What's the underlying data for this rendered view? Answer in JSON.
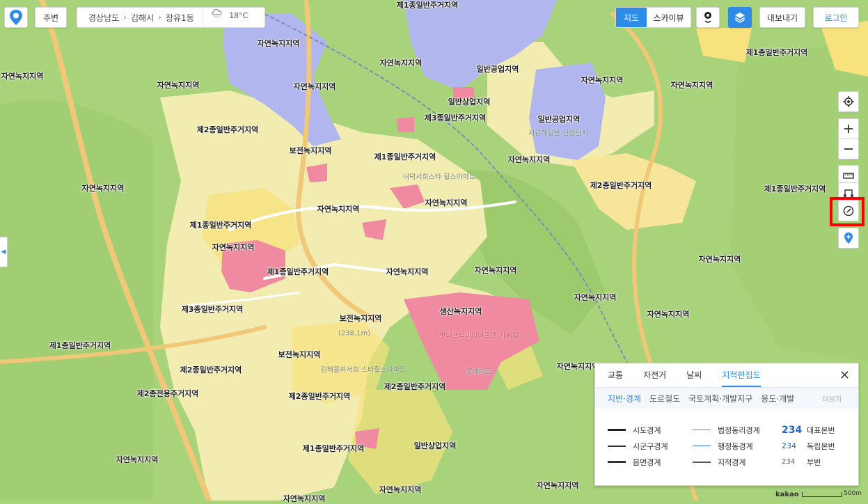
{
  "topbar": {
    "nearby_label": "주변",
    "breadcrumb": [
      "경상남도",
      "김해시",
      "장유1동"
    ],
    "weather_temp": "18°C",
    "map_type_map": "지도",
    "map_type_sky": "스카이뷰",
    "export_label": "내보내기",
    "login_label": "로그인"
  },
  "map_labels": [
    "제1종일반주거지역",
    "제1종일반주거지역",
    "자연녹지지역",
    "자연녹지지역",
    "일반공업지역",
    "자연녹지지역",
    "자연녹지지역",
    "자연녹지지역",
    "자연녹지지역",
    "자연녹지지역",
    "일반상업지역",
    "제3종일반주거지역",
    "일반공업지역",
    "제2종일반주거지역",
    "보전녹지지역",
    "제1종일반주거지역",
    "자연녹지지역",
    "자연녹지지역",
    "제2종일반주거지역",
    "제1종일반주거지역",
    "자연녹지지역",
    "자연녹지지역",
    "제1종일반주거지역",
    "자연녹지지역",
    "자연녹지지역",
    "제1종일반주거지역",
    "자연녹지지역",
    "자연녹지지역",
    "자연녹지지역",
    "자연녹지지역",
    "제3종일반주거지역",
    "생산녹지지역",
    "보전녹지지역",
    "자연녹지지역",
    "제1종일반주거지역",
    "보전녹지지역",
    "제2종일반주거지역",
    "제2종일반주거지역",
    "제2종전용주거지역",
    "제2종일반주거지역",
    "일반상업지역",
    "제1종일반주거지역",
    "자연녹지지역",
    "자연녹지지역",
    "자연녹지지역",
    "자연녹지지역"
  ],
  "poi_labels": [
    "서김해일반 산업단지",
    "롯데프리미엄아울렛 김해점",
    "(238.1m)",
    "롯데마트",
    "내덕서희스타 힐스아파트",
    "김해율하서희 스타힐스아파트"
  ],
  "panel": {
    "tabs": [
      "교통",
      "자전거",
      "날씨",
      "지적편집도"
    ],
    "active_tab": "지적편집도",
    "subtabs": [
      "지번·경계",
      "도로철도",
      "국토계획·개발지구",
      "용도·개발"
    ],
    "active_subtab": "지번·경계",
    "more_label": "더보기",
    "legend": [
      {
        "label": "시도경계"
      },
      {
        "label": "법정동리경계"
      },
      {
        "number": "234",
        "label": "대표본번"
      },
      {
        "label": "시군구경계"
      },
      {
        "label": "행정동경계"
      },
      {
        "number": "234",
        "label": "독립본번"
      },
      {
        "label": "읍면경계"
      },
      {
        "label": "지적경계"
      },
      {
        "number": "234",
        "label": "부번"
      }
    ]
  },
  "scale": {
    "brand": "kakao",
    "distance": "500m"
  },
  "colors": {
    "green": "#a9d37a",
    "residential": "#f3ecb0",
    "residential2": "#f7e27e",
    "commercial": "#f08aa0",
    "industrial": "#b2b6ee",
    "accent": "#2e8be8",
    "highlight": "#ff0000"
  },
  "icons": [
    "kakao-map-logo-icon",
    "weather-cloud-icon",
    "streetview-icon",
    "layers-icon",
    "gps-icon",
    "zoom-in-icon",
    "zoom-out-icon",
    "ruler-icon",
    "route-icon",
    "compass-icon",
    "pin-icon",
    "collapse-arrow-icon",
    "close-icon"
  ]
}
